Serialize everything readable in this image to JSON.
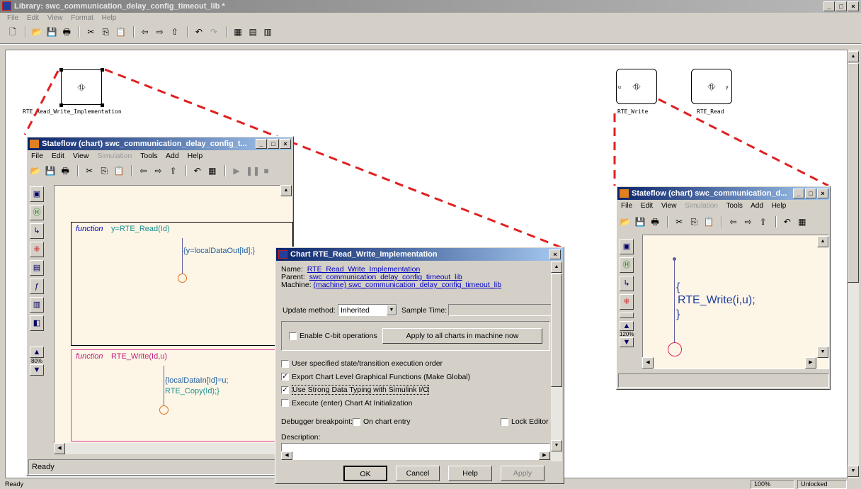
{
  "library": {
    "title": "Library: swc_communication_delay_config_timeout_lib *",
    "menu": [
      "File",
      "Edit",
      "View",
      "Format",
      "Help"
    ],
    "blocks": {
      "impl": "RTE_Read_Write_Implementation",
      "write": "RTE_Write",
      "read": "RTE_Read",
      "port_in": "u",
      "port_out": "y"
    },
    "status": {
      "left": "Ready",
      "zoom": "100%",
      "lock": "Unlocked"
    }
  },
  "sf_left": {
    "title": "Stateflow (chart) swc_communication_delay_config_t...",
    "menu": [
      "File",
      "Edit",
      "View",
      "Simulation",
      "Tools",
      "Add",
      "Help"
    ],
    "zoom": "80%",
    "status": "Ready",
    "fn1": {
      "kw": "function",
      "sig": "y=RTE_Read(Id)",
      "action": "{y=localDataOut[Id];}"
    },
    "fn2": {
      "kw": "function",
      "sig": "RTE_Write(Id,u)",
      "action1": "{localDataIn[Id]=u;",
      "action2": "RTE_Copy(Id);}"
    }
  },
  "sf_right": {
    "title": "Stateflow (chart) swc_communication_d...",
    "menu": [
      "File",
      "Edit",
      "View",
      "Simulation",
      "Tools",
      "Add",
      "Help"
    ],
    "zoom": "120%",
    "action1": "{",
    "action2": "RTE_Write(i,u);",
    "action3": "}"
  },
  "dialog": {
    "title": "Chart RTE_Read_Write_Implementation",
    "name_label": "Name:",
    "name": "RTE_Read_Write_Implementation",
    "parent_label": "Parent:",
    "parent": "swc_communication_delay_config_timeout_lib",
    "machine_label": "Machine:",
    "machine": "(machine) swc_communication_delay_config_timeout_lib",
    "update_label": "Update method:",
    "update_value": "Inherited",
    "sample_label": "Sample Time:",
    "enable_cbit": "Enable C-bit operations",
    "apply_all": "Apply to all charts in machine now",
    "opt1": "User specified state/transition execution order",
    "opt2": "Export Chart Level Graphical Functions (Make Global)",
    "opt3": "Use Strong Data Typing with Simulink I/O",
    "opt4": "Execute (enter) Chart At Initialization",
    "debug_label": "Debugger breakpoint:",
    "on_entry": "On chart entry",
    "lock_editor": "Lock Editor",
    "desc_label": "Description:",
    "ok": "OK",
    "cancel": "Cancel",
    "help": "Help",
    "apply": "Apply"
  }
}
